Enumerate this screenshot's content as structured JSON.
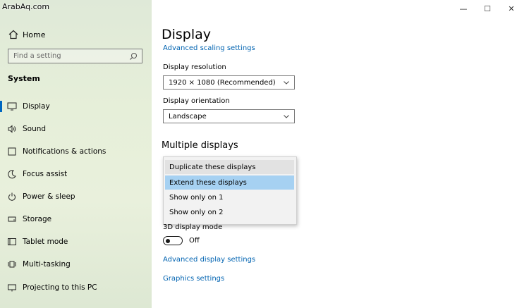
{
  "watermark": "ArabAq.com",
  "sidebar": {
    "home_label": "Home",
    "search_placeholder": "Find a setting",
    "section_title": "System",
    "items": [
      {
        "label": "Display",
        "icon": "monitor-icon"
      },
      {
        "label": "Sound",
        "icon": "speaker-icon"
      },
      {
        "label": "Notifications & actions",
        "icon": "notification-icon"
      },
      {
        "label": "Focus assist",
        "icon": "moon-icon"
      },
      {
        "label": "Power & sleep",
        "icon": "power-icon"
      },
      {
        "label": "Storage",
        "icon": "storage-icon"
      },
      {
        "label": "Tablet mode",
        "icon": "tablet-icon"
      },
      {
        "label": "Multi-tasking",
        "icon": "multitasking-icon"
      },
      {
        "label": "Projecting to this PC",
        "icon": "projector-icon"
      }
    ]
  },
  "window": {
    "minimize": "—",
    "maximize": "☐",
    "close": "✕"
  },
  "main": {
    "title": "Display",
    "advanced_scaling_link": "Advanced scaling settings",
    "resolution_label": "Display resolution",
    "resolution_value": "1920 × 1080 (Recommended)",
    "orientation_label": "Display orientation",
    "orientation_value": "Landscape",
    "multiple_displays_heading": "Multiple displays",
    "multiple_displays_options": [
      "Duplicate these displays",
      "Extend these displays",
      "Show only on 1",
      "Show only on 2"
    ],
    "three_d_label": "3D display mode",
    "three_d_state": "Off",
    "advanced_display_link": "Advanced display settings",
    "graphics_link": "Graphics settings"
  },
  "colors": {
    "accent": "#0067c0",
    "link": "#0063b1",
    "selected_option": "#a6d1f2"
  }
}
